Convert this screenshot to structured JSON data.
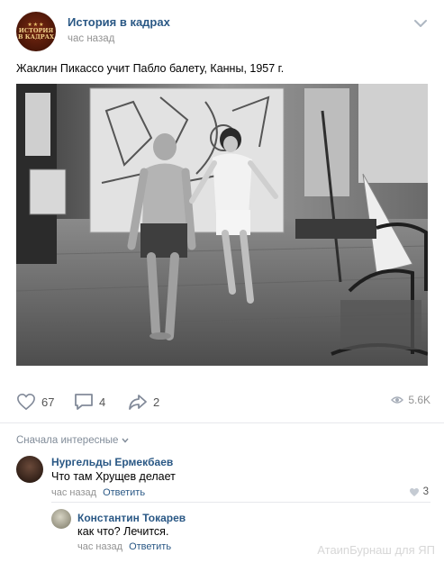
{
  "post": {
    "group_name": "История в кадрах",
    "avatar_logo_lines": [
      "ИСТОРИЯ",
      "В КАДРАХ"
    ],
    "time": "час назад",
    "text": "Жаклин Пикассо учит Пабло балету, Канны, 1957 г.",
    "likes": "67",
    "comments": "4",
    "shares": "2",
    "views": "5.6K"
  },
  "comments_section": {
    "sort_label": "Сначала интересные",
    "items": [
      {
        "author": "Нургельды Ермекбаев",
        "text": "Что там Хрущев делает",
        "time": "час назад",
        "reply_label": "Ответить",
        "likes": "3"
      },
      {
        "author": "Константин Токарев",
        "text": "как что? Лечится.",
        "time": "час назад",
        "reply_label": "Ответить"
      }
    ]
  },
  "watermark": "АтаиnБурнаш для ЯП",
  "colors": {
    "link": "#2a5885",
    "secondary": "#939393",
    "divider": "#e7e8ec"
  }
}
